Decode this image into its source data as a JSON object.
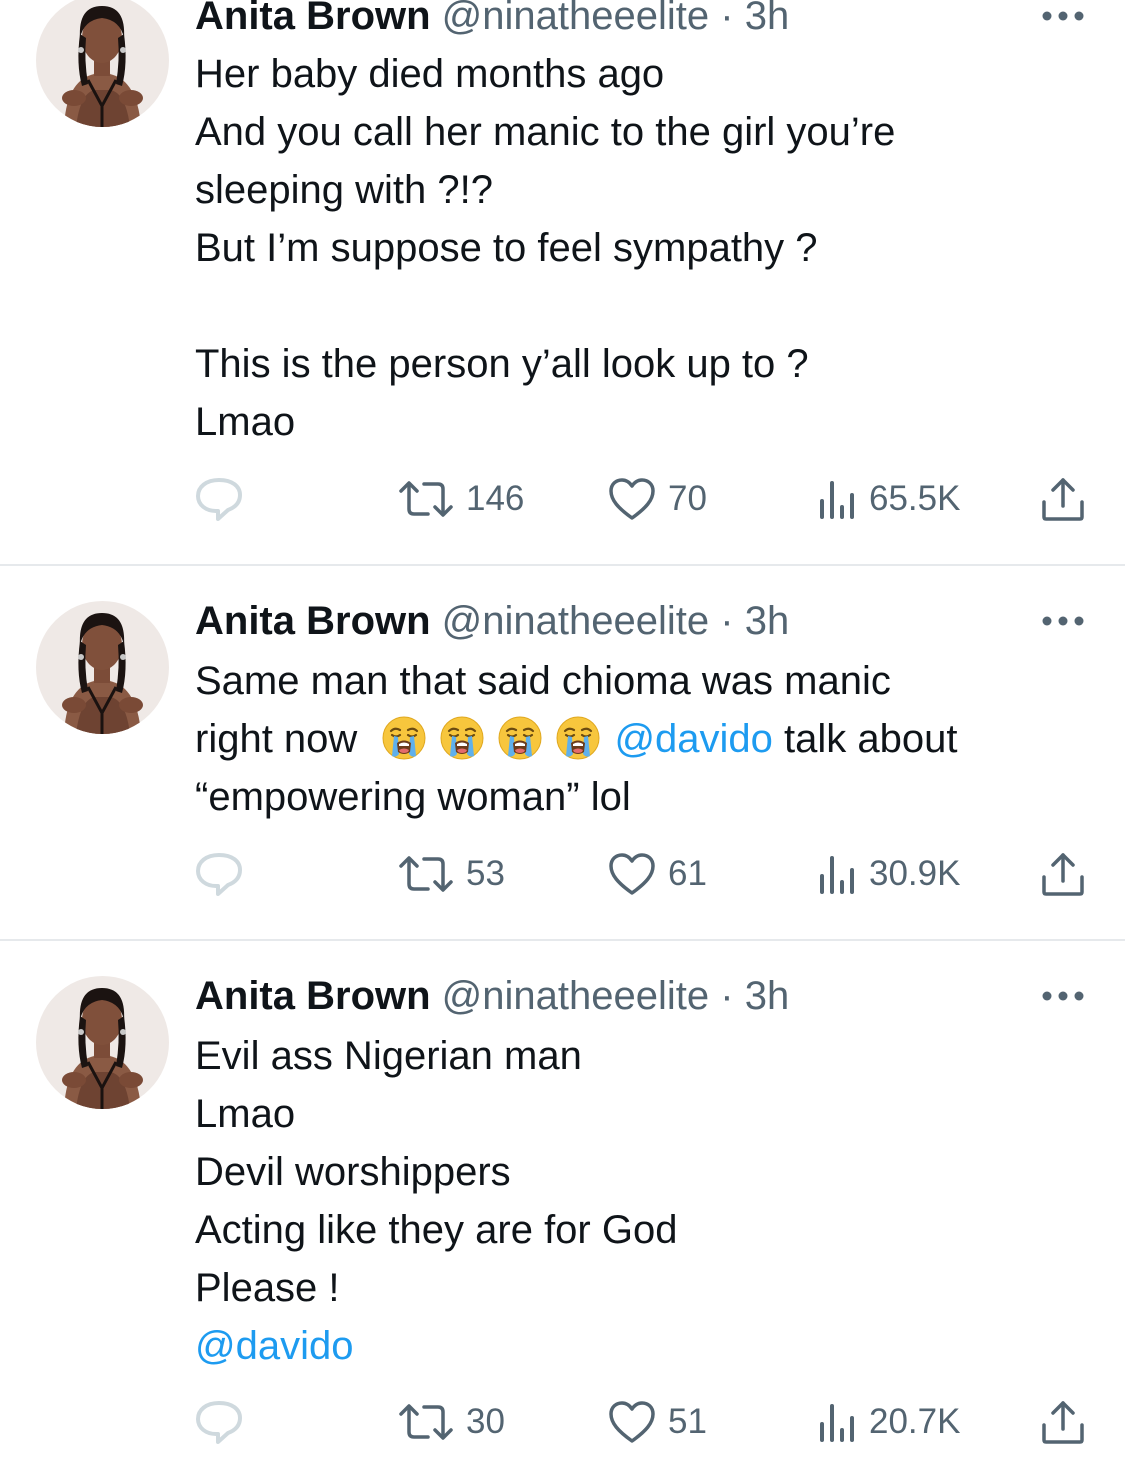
{
  "tweets": [
    {
      "name": "Anita Brown",
      "handle": "@ninatheeelite",
      "separator": "·",
      "time": "3h",
      "lines": [
        "Her baby died months ago",
        "And you call her manic to the girl you’re",
        "sleeping with ?!?",
        "But I’m suppose to feel sympathy ?",
        "",
        "This is the person y’all look up to ?",
        "Lmao"
      ],
      "retweets": "146",
      "likes": "70",
      "views": "65.5K"
    },
    {
      "name": "Anita Brown",
      "handle": "@ninatheeelite",
      "separator": "·",
      "time": "3h",
      "line1": "Same man that said chioma was manic",
      "line2_prefix": "right now",
      "line2_mention": "@davido",
      "line2_suffix": " talk about",
      "line3": "“empowering woman” lol",
      "emojis": [
        "loudly-crying-face",
        "loudly-crying-face",
        "loudly-crying-face",
        "loudly-crying-face"
      ],
      "retweets": "53",
      "likes": "61",
      "views": "30.9K"
    },
    {
      "name": "Anita Brown",
      "handle": "@ninatheeelite",
      "separator": "·",
      "time": "3h",
      "lines": [
        "Evil ass Nigerian man",
        "Lmao",
        "Devil worshippers",
        "Acting like they are for God",
        "Please !"
      ],
      "mention": "@davido",
      "retweets": "30",
      "likes": "51",
      "views": "20.7K"
    }
  ],
  "colors": {
    "text": "#0f1419",
    "secondary": "#536471",
    "link": "#1d9bf0",
    "icon": "#536471",
    "reply_icon": "#cfd9de",
    "divider": "#e6e9ec"
  },
  "icons": [
    "avatar",
    "more-icon",
    "reply-icon",
    "retweet-icon",
    "like-icon",
    "views-icon",
    "share-icon"
  ]
}
